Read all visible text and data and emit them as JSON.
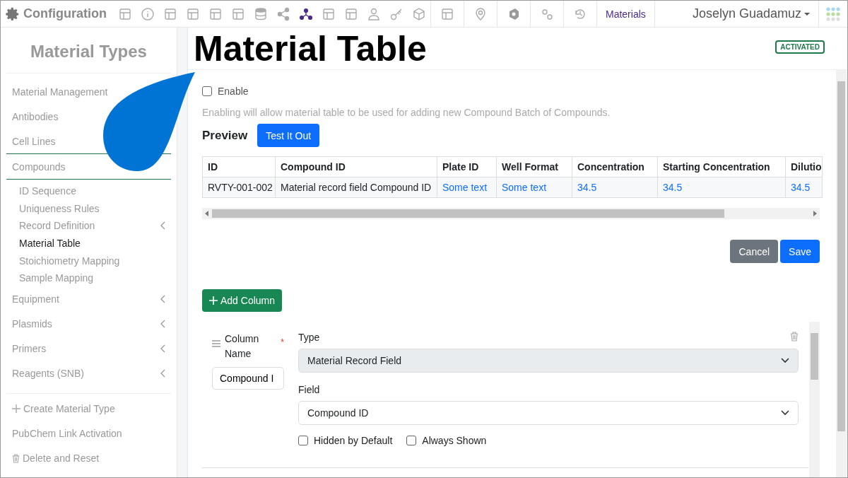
{
  "topbar": {
    "app_title": "Configuration",
    "link": "Materials",
    "user": "Joselyn Guadamuz"
  },
  "sidebar": {
    "title": "Material Types",
    "items": [
      {
        "label": "Material Management",
        "expanded": false,
        "selected": false
      },
      {
        "label": "Antibodies",
        "expanded": false,
        "selected": false
      },
      {
        "label": "Cell Lines",
        "expanded": false,
        "selected": false
      },
      {
        "label": "Compounds",
        "has_submenu": false,
        "expanded": true,
        "selected": false,
        "children": [
          {
            "label": "ID Sequence",
            "has_submenu": false,
            "selected": false
          },
          {
            "label": "Uniqueness Rules",
            "has_submenu": false,
            "selected": false
          },
          {
            "label": "Record Definition",
            "has_submenu": true,
            "selected": false
          },
          {
            "label": "Material Table",
            "has_submenu": false,
            "selected": true
          },
          {
            "label": "Stoichiometry Mapping",
            "has_submenu": false,
            "selected": false
          },
          {
            "label": "Sample Mapping",
            "has_submenu": false,
            "selected": false
          }
        ]
      },
      {
        "label": "Equipment",
        "has_submenu": true,
        "expanded": false,
        "selected": false
      },
      {
        "label": "Plasmids",
        "has_submenu": true,
        "expanded": false,
        "selected": false
      },
      {
        "label": "Primers",
        "has_submenu": true,
        "expanded": false,
        "selected": false
      },
      {
        "label": "Reagents (SNB)",
        "has_submenu": true,
        "expanded": false,
        "selected": false
      }
    ],
    "actions": [
      {
        "label": "Create Material Type",
        "kind": "plus"
      },
      {
        "label": "PubChem Link Activation",
        "kind": "plain"
      },
      {
        "label": "Delete and Reset",
        "kind": "trash"
      }
    ]
  },
  "page": {
    "title": "Material Table",
    "status": "ACTIVATED",
    "enable": {
      "label": "Enable",
      "checked": false
    },
    "help": "Enabling will allow material table to be used for adding new Compound Batch of Compounds.",
    "preview": {
      "title": "Preview",
      "button": "Test It Out",
      "columns": [
        "ID",
        "Compound ID",
        "Plate ID",
        "Well Format",
        "Concentration",
        "Starting Concentration",
        "Dilutio"
      ],
      "rows": [
        [
          {
            "text": "RVTY-001-002",
            "kind": "text"
          },
          {
            "text": "Material record field Compound ID",
            "kind": "text"
          },
          {
            "text": "Some text",
            "kind": "link"
          },
          {
            "text": "Some text",
            "kind": "link"
          },
          {
            "text": "34.5",
            "kind": "link"
          },
          {
            "text": "34.5",
            "kind": "link"
          },
          {
            "text": "34.5",
            "kind": "link"
          }
        ]
      ]
    },
    "buttons": {
      "cancel": "Cancel",
      "save": "Save"
    },
    "add_column": "Add Column",
    "column_editor": {
      "name_label": "Column Name",
      "required": "*",
      "name_value": "Compound I",
      "type_label": "Type",
      "type_value": "Material Record Field",
      "type_disabled": true,
      "field_label": "Field",
      "field_value": "Compound ID",
      "options": [
        {
          "label": "Hidden by Default",
          "checked": false
        },
        {
          "label": "Always Shown",
          "checked": false
        }
      ]
    }
  }
}
